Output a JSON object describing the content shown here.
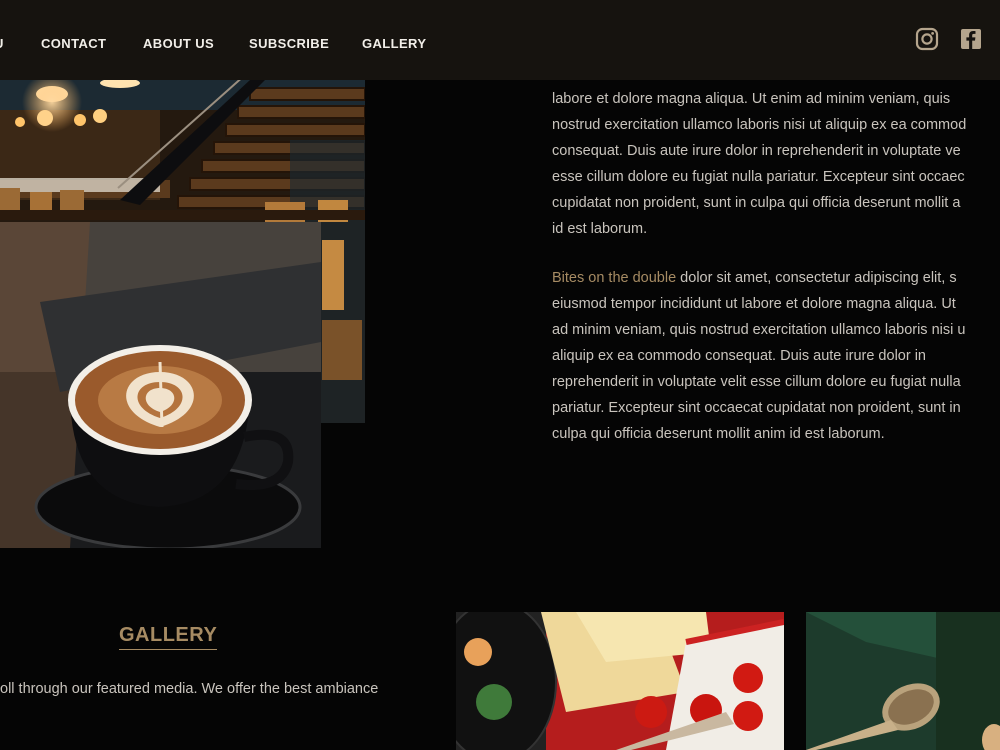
{
  "nav": {
    "items": [
      {
        "label": "U"
      },
      {
        "label": "CONTACT"
      },
      {
        "label": "ABOUT US"
      },
      {
        "label": "SUBSCRIBE"
      },
      {
        "label": "GALLERY"
      }
    ],
    "social": [
      "instagram-icon",
      "facebook-icon"
    ]
  },
  "about": {
    "para1_lines": [
      "labore et dolore magna aliqua. Ut enim ad minim veniam, quis",
      "nostrud exercitation ullamco laboris nisi ut aliquip ex ea commod",
      "consequat. Duis aute irure dolor in reprehenderit in voluptate ve",
      "esse cillum dolore eu fugiat nulla pariatur. Excepteur sint occaec",
      "cupidatat non proident, sunt in culpa qui officia deserunt mollit a",
      "id est laborum."
    ],
    "para2_highlight": "Bites on the double",
    "para2_first_rest": " dolor sit amet, consectetur adipiscing elit, s",
    "para2_lines": [
      "eiusmod tempor incididunt ut labore et dolore magna aliqua. Ut",
      "ad minim veniam, quis nostrud exercitation ullamco laboris nisi u",
      "aliquip ex ea commodo consequat. Duis aute irure dolor in",
      "reprehenderit in voluptate velit esse cillum dolore eu fugiat nulla",
      "pariatur. Excepteur sint occaecat cupidatat non proident, sunt in",
      "culpa qui officia deserunt mollit anim id est laborum."
    ]
  },
  "gallery": {
    "heading": "GALLERY",
    "text": "oll through our featured media. We offer the best ambiance"
  },
  "colors": {
    "accent": "#a68b63",
    "header_bg": "#16130f",
    "page_bg": "#050505",
    "icon": "#b5a58d"
  }
}
